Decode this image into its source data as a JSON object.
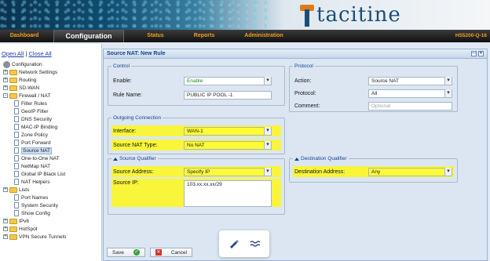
{
  "brand": "tacitine",
  "nav": {
    "items": [
      "Dashboard",
      "Configuration",
      "Status",
      "Reports",
      "Administration"
    ],
    "active": "Configuration",
    "model": "HS5200-Q-16"
  },
  "sidebar": {
    "open_all": "Open All",
    "separator": "|",
    "close_all": "Close All",
    "tree": [
      {
        "label": "Configuration",
        "type": "root"
      },
      {
        "label": "Network Settings",
        "type": "folder",
        "toggle": "+"
      },
      {
        "label": "Routing",
        "type": "folder",
        "toggle": "+"
      },
      {
        "label": "SD-WAN",
        "type": "folder",
        "toggle": "+"
      },
      {
        "label": "Firewall / NAT",
        "type": "folder-open",
        "toggle": "-"
      },
      {
        "label": "Filter Rules",
        "type": "page"
      },
      {
        "label": "GeoIP Filter",
        "type": "page"
      },
      {
        "label": "DNS Security",
        "type": "page"
      },
      {
        "label": "MAC-IP Binding",
        "type": "page"
      },
      {
        "label": "Zone Policy",
        "type": "page"
      },
      {
        "label": "Port Forward",
        "type": "page"
      },
      {
        "label": "Source NAT",
        "type": "page",
        "selected": true
      },
      {
        "label": "One-to-One NAT",
        "type": "page"
      },
      {
        "label": "NetMap NAT",
        "type": "page"
      },
      {
        "label": "Global IP Black List",
        "type": "page"
      },
      {
        "label": "NAT Helpers",
        "type": "page"
      },
      {
        "label": "Lists",
        "type": "folder",
        "toggle": "+"
      },
      {
        "label": "Port Names",
        "type": "page"
      },
      {
        "label": "System Security",
        "type": "page"
      },
      {
        "label": "Show Config",
        "type": "page"
      },
      {
        "label": "IPv6",
        "type": "folder",
        "toggle": "+"
      },
      {
        "label": "HotSpot",
        "type": "folder",
        "toggle": "+"
      },
      {
        "label": "VPN Secure Tunnels",
        "type": "folder",
        "toggle": "+"
      }
    ]
  },
  "panel": {
    "title": "Source NAT: New Rule",
    "control": {
      "legend": "Control",
      "enable_label": "Enable:",
      "enable_value": "Enable",
      "rule_name_label": "Rule Name:",
      "rule_name_value": "PUBLIC IP POOL -1"
    },
    "protocol": {
      "legend": "Protocol",
      "action_label": "Action:",
      "action_value": "Source NAT",
      "protocol_label": "Protocol:",
      "protocol_value": "All",
      "comment_label": "Comment:",
      "comment_placeholder": "Optional"
    },
    "outgoing": {
      "legend": "Outgoing Connection",
      "interface_label": "Interface:",
      "interface_value": "WAN-1",
      "nat_type_label": "Source NAT Type:",
      "nat_type_value": "No NAT"
    },
    "source_qualifier": {
      "legend": "Source Qualifier",
      "address_label": "Source Address:",
      "address_value": "Specify IP",
      "ip_label": "Source IP:",
      "ip_value": "103.xx.xx.xx/29"
    },
    "destination_qualifier": {
      "legend": "Destination Qualifier",
      "address_label": "Destination Address:",
      "address_value": "Any"
    },
    "save_label": "Save",
    "cancel_label": "Cancel"
  },
  "colors": {
    "highlight": "#fdfb36",
    "nav_text": "#f0a020",
    "panel_title": "#15428b"
  }
}
